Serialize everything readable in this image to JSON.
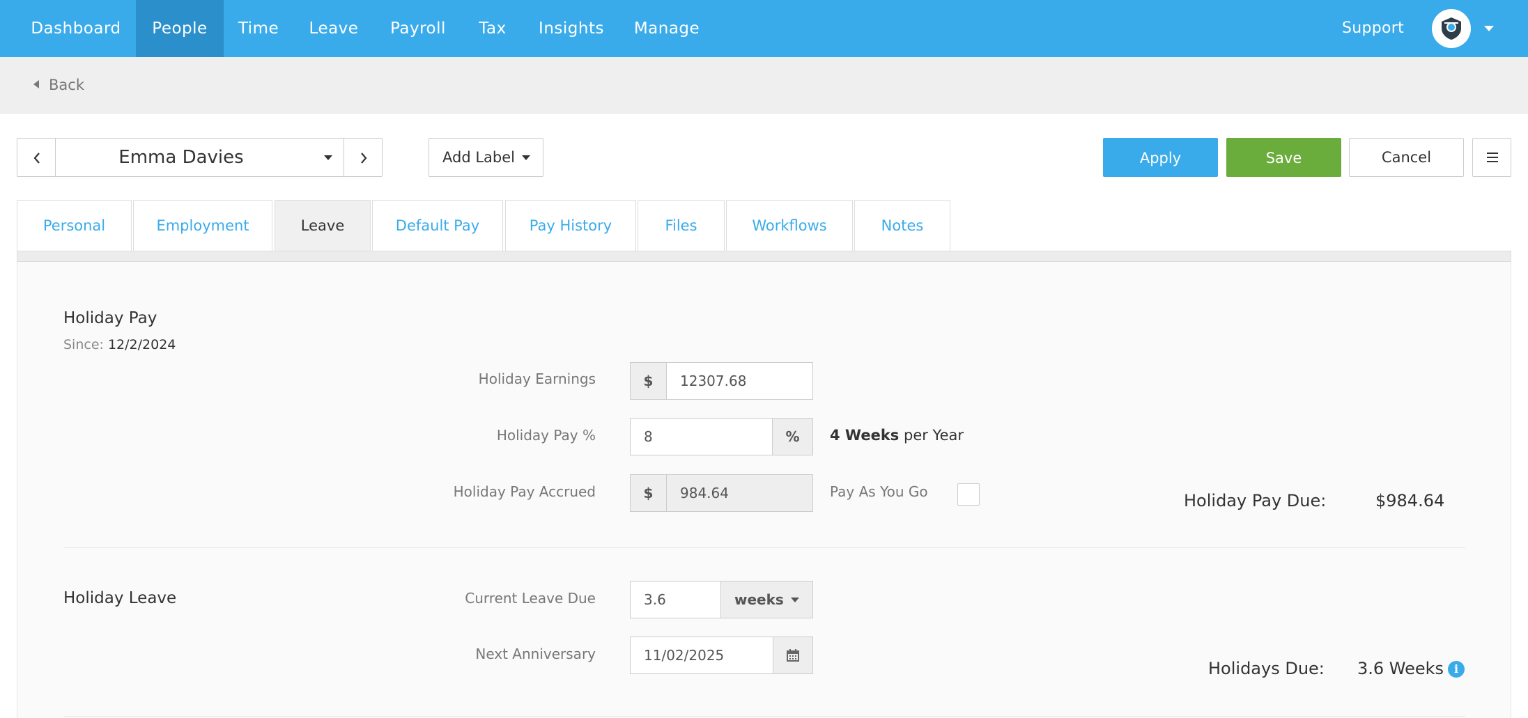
{
  "nav": {
    "items": [
      {
        "label": "Dashboard",
        "active": false
      },
      {
        "label": "People",
        "active": true
      },
      {
        "label": "Time",
        "active": false
      },
      {
        "label": "Leave",
        "active": false
      },
      {
        "label": "Payroll",
        "active": false
      },
      {
        "label": "Tax",
        "active": false
      },
      {
        "label": "Insights",
        "active": false
      },
      {
        "label": "Manage",
        "active": false
      }
    ],
    "support": "Support",
    "accent": "#3aabea"
  },
  "back": {
    "label": "Back"
  },
  "toolbar": {
    "person": "Emma Davies",
    "add_label": "Add Label",
    "apply": "Apply",
    "save": "Save",
    "cancel": "Cancel",
    "save_color": "#6aad3d"
  },
  "tabs": [
    {
      "label": "Personal",
      "active": false
    },
    {
      "label": "Employment",
      "active": false
    },
    {
      "label": "Leave",
      "active": true
    },
    {
      "label": "Default Pay",
      "active": false
    },
    {
      "label": "Pay History",
      "active": false
    },
    {
      "label": "Files",
      "active": false
    },
    {
      "label": "Workflows",
      "active": false
    },
    {
      "label": "Notes",
      "active": false
    }
  ],
  "holiday_pay": {
    "title": "Holiday Pay",
    "since_label": "Since:",
    "since_value": "12/2/2024",
    "earnings_label": "Holiday Earnings",
    "earnings_prefix": "$",
    "earnings_value": "12307.68",
    "percent_label": "Holiday Pay %",
    "percent_value": "8",
    "percent_suffix": "%",
    "weeks_bold": "4 Weeks",
    "weeks_rest": "per Year",
    "accrued_label": "Holiday Pay Accrued",
    "accrued_prefix": "$",
    "accrued_value": "984.64",
    "payg_label": "Pay As You Go",
    "payg_checked": false,
    "due_label": "Holiday Pay Due:",
    "due_value": "$984.64"
  },
  "holiday_leave": {
    "title": "Holiday Leave",
    "current_label": "Current Leave Due",
    "current_value": "3.6",
    "unit": "weeks",
    "anniversary_label": "Next Anniversary",
    "anniversary_value": "11/02/2025",
    "due_label": "Holidays Due:",
    "due_value": "3.6 Weeks"
  }
}
